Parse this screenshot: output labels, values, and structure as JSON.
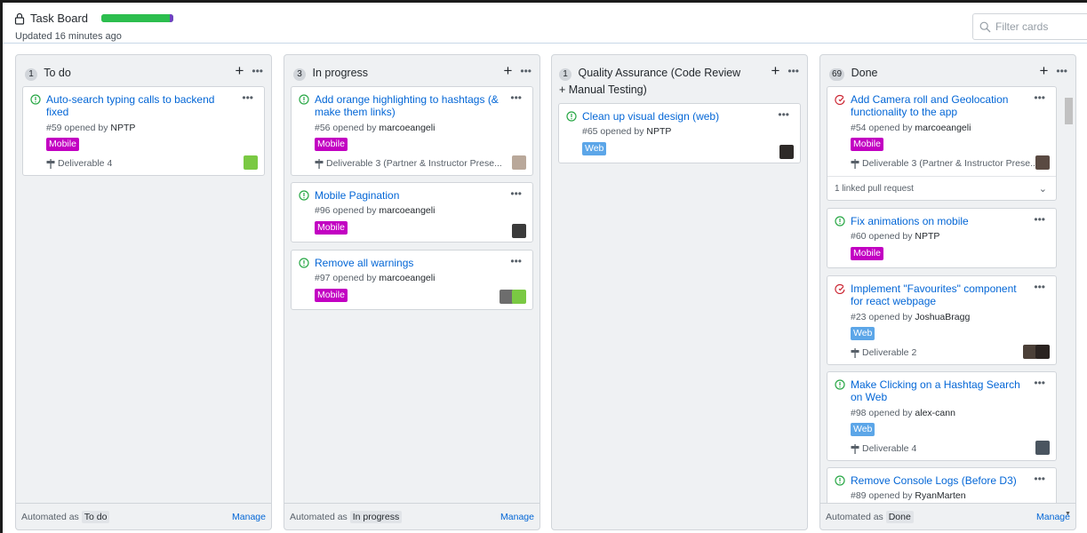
{
  "header": {
    "title": "Task Board",
    "updated": "Updated 16 minutes ago",
    "progress": {
      "done_fraction": 0.95,
      "in_progress_fraction": 0.05
    },
    "filter_placeholder": "Filter cards",
    "colors": {
      "done": "#2cbe4e",
      "in_progress": "#6f42c1"
    }
  },
  "columns": [
    {
      "count": "1",
      "name": "To do",
      "automation_prefix": "Automated as",
      "automation": "To do",
      "manage": "Manage",
      "cards": [
        {
          "title": "Auto-search typing calls to backend fixed",
          "meta_prefix": "#59 opened by",
          "author": "NPTP",
          "label": "Mobile",
          "milestone": "Deliverable 4",
          "state": "open"
        }
      ]
    },
    {
      "count": "3",
      "name": "In progress",
      "automation_prefix": "Automated as",
      "automation": "In progress",
      "manage": "Manage",
      "cards": [
        {
          "title": "Add orange highlighting to hashtags (& make them links)",
          "meta_prefix": "#56 opened by",
          "author": "marcoeangeli",
          "label": "Mobile",
          "milestone": "Deliverable 3 (Partner & Instructor Prese...",
          "state": "open"
        },
        {
          "title": "Mobile Pagination",
          "meta_prefix": "#96 opened by",
          "author": "marcoeangeli",
          "label": "Mobile",
          "state": "open"
        },
        {
          "title": "Remove all warnings",
          "meta_prefix": "#97 opened by",
          "author": "marcoeangeli",
          "label": "Mobile",
          "state": "open"
        }
      ]
    },
    {
      "count": "1",
      "name": "Quality Assurance (Code Review + Manual Testing)",
      "automation_prefix": "",
      "automation": "",
      "manage": "",
      "cards": [
        {
          "title": "Clean up visual design (web)",
          "meta_prefix": "#65 opened by",
          "author": "NPTP",
          "label": "Web",
          "state": "open"
        }
      ]
    },
    {
      "count": "69",
      "name": "Done",
      "automation_prefix": "Automated as",
      "automation": "Done",
      "manage": "Manage",
      "cards": [
        {
          "title": "Add Camera roll and Geolocation functionality to the app",
          "meta_prefix": "#54 opened by",
          "author": "marcoeangeli",
          "label": "Mobile",
          "milestone": "Deliverable 3 (Partner & Instructor Prese...",
          "linked": "1 linked pull request",
          "state": "closed"
        },
        {
          "title": "Fix animations on mobile",
          "meta_prefix": "#60 opened by",
          "author": "NPTP",
          "label": "Mobile",
          "state": "open"
        },
        {
          "title": "Implement \"Favourites\" component for react webpage",
          "meta_prefix": "#23 opened by",
          "author": "JoshuaBragg",
          "label": "Web",
          "milestone": "Deliverable 2",
          "state": "closed"
        },
        {
          "title": "Make Clicking on a Hashtag Search on Web",
          "meta_prefix": "#98 opened by",
          "author": "alex-cann",
          "label": "Web",
          "milestone": "Deliverable 4",
          "state": "open"
        },
        {
          "title": "Remove Console Logs (Before D3)",
          "meta_prefix": "#89 opened by",
          "author": "RyanMarten",
          "state": "open"
        }
      ]
    }
  ],
  "icons": {
    "open_issue": "issue-open-icon",
    "closed_issue": "issue-closed-icon",
    "milestone": "milestone-icon",
    "lock": "lock-icon",
    "search": "search-icon"
  },
  "label_colors": {
    "Mobile": "#c200c2",
    "Web": "#5ca6e8"
  },
  "state_colors": {
    "open": "#28a745",
    "closed": "#cb2431"
  }
}
